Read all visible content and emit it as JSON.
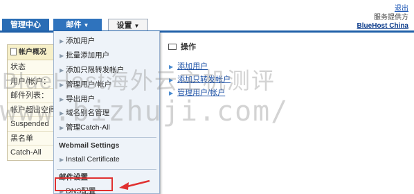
{
  "header": {
    "logout": "退出",
    "provider_label": "服务提供方",
    "provider_name": "BlueHost China"
  },
  "nav": {
    "home": "管理中心",
    "mail": "邮件",
    "settings": "设置"
  },
  "sidebar": {
    "title": "帐户概况",
    "items": [
      {
        "label": "状态"
      },
      {
        "label": "用户/帐户："
      },
      {
        "label": "邮件列表："
      },
      {
        "label": "帐户超出空间"
      },
      {
        "label": "Suspended"
      },
      {
        "label": "黑名单"
      },
      {
        "label": "Catch-All"
      }
    ]
  },
  "mail_menu": {
    "items": [
      {
        "label": "添加用户"
      },
      {
        "label": "批量添加用户"
      },
      {
        "label": "添加只限转发帐户"
      },
      {
        "label": "管理用户/帐户"
      },
      {
        "label": "导出用户"
      },
      {
        "label": "域名别名管理"
      },
      {
        "label": "管理Catch-All"
      }
    ],
    "webmail_title": "Webmail Settings",
    "webmail_items": [
      {
        "label": "Install Certificate"
      }
    ],
    "mail_settings_title": "邮件设置",
    "mail_settings_items": [
      {
        "label": "DNS配置"
      }
    ]
  },
  "operations": {
    "title": "操作",
    "links": [
      {
        "label": "添加用户"
      },
      {
        "label": "添加只转发帐户"
      },
      {
        "label": "管理用户/帐户"
      }
    ]
  },
  "watermark": {
    "line1": "BlueHost海外云主机测评",
    "line2": "www.bizhuji.com/"
  },
  "colors": {
    "nav_blue": "#2a6db5",
    "highlight": "#e03030",
    "link": "#1a4fa5"
  }
}
